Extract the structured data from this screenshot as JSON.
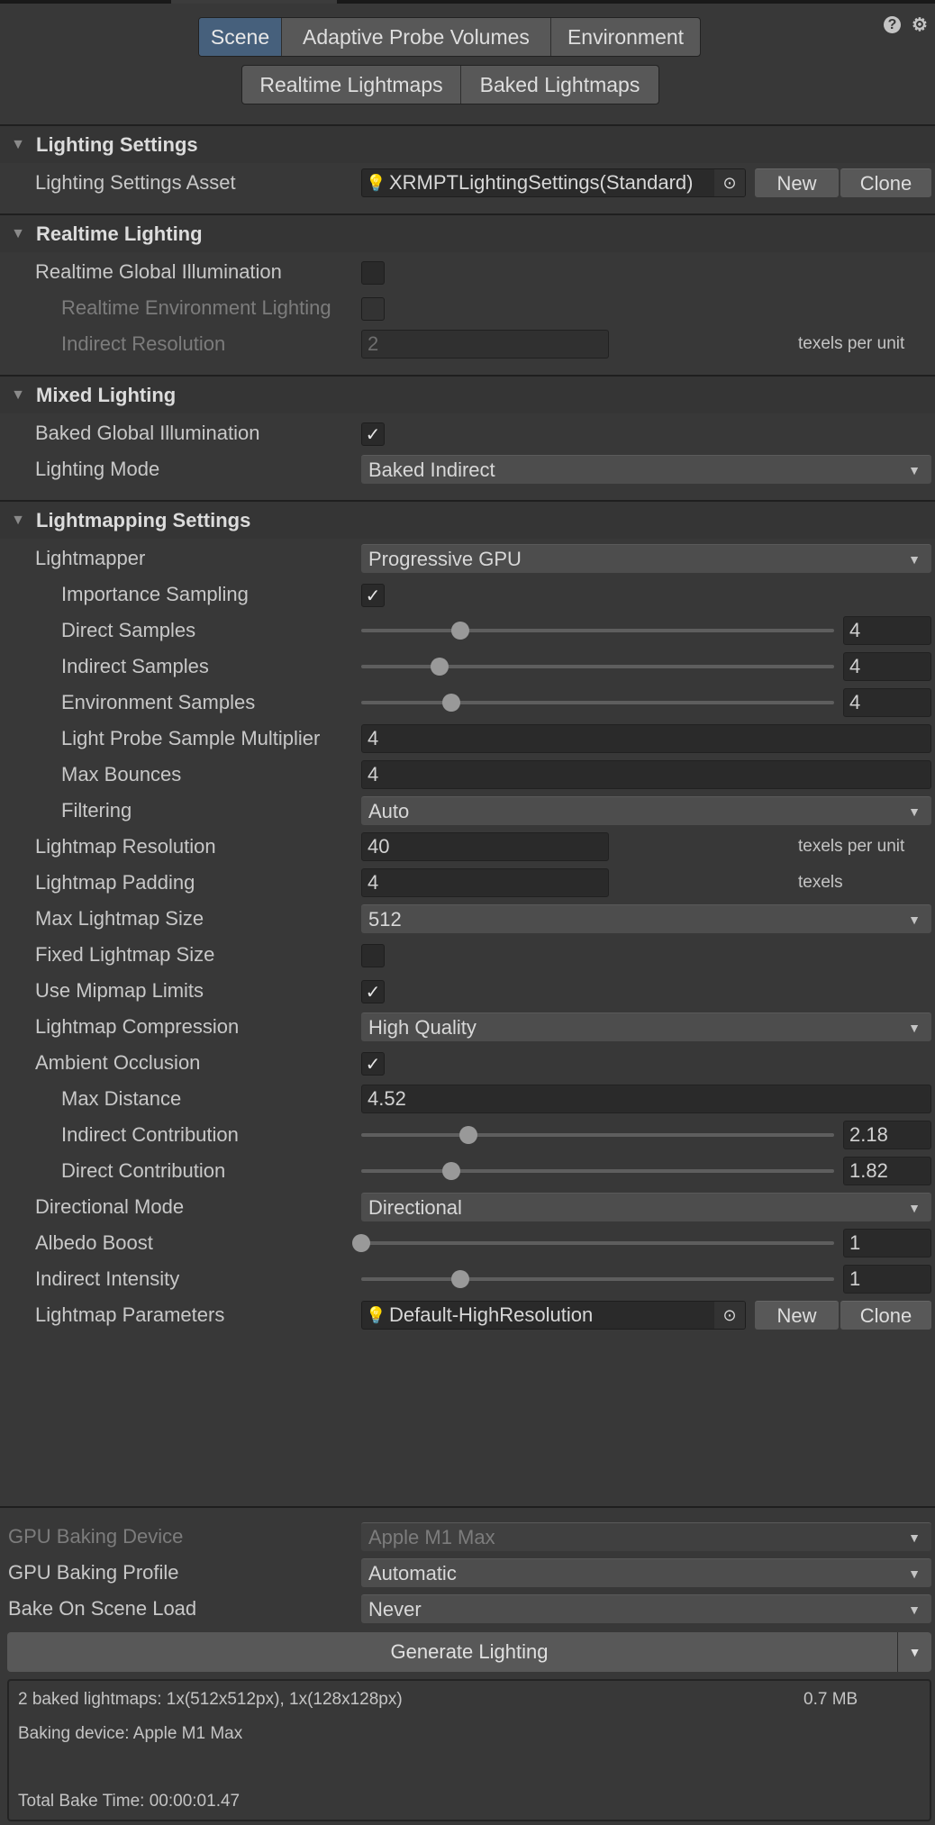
{
  "tabs": {
    "row1": [
      "Scene",
      "Adaptive Probe Volumes",
      "Environment"
    ],
    "row2": [
      "Realtime Lightmaps",
      "Baked Lightmaps"
    ],
    "selected": "Scene"
  },
  "icons": {
    "help": "?",
    "settings": "⚙"
  },
  "sections": [
    {
      "title": "Lighting Settings",
      "rows": [
        {
          "label": "Lighting Settings Asset",
          "type": "object",
          "value": "XRMPTLightingSettings(Standard)",
          "icon": "lightbulb-settings-icon",
          "new_label": "New",
          "clone_label": "Clone"
        }
      ]
    },
    {
      "title": "Realtime Lighting",
      "rows": [
        {
          "label": "Realtime Global Illumination",
          "type": "checkbox",
          "checked": false
        },
        {
          "label": "Realtime Environment Lighting",
          "type": "checkbox",
          "checked": false,
          "indent": true,
          "disabled": true
        },
        {
          "label": "Indirect Resolution",
          "type": "number",
          "value": "2",
          "units": "texels per unit",
          "indent": true,
          "disabled": true
        }
      ]
    },
    {
      "title": "Mixed Lighting",
      "rows": [
        {
          "label": "Baked Global Illumination",
          "type": "checkbox",
          "checked": true
        },
        {
          "label": "Lighting Mode",
          "type": "dropdown",
          "value": "Baked Indirect"
        }
      ]
    },
    {
      "title": "Lightmapping Settings",
      "rows": [
        {
          "label": "Lightmapper",
          "type": "dropdown",
          "value": "Progressive GPU"
        },
        {
          "label": "Importance Sampling",
          "type": "checkbox",
          "checked": true,
          "indent": true
        },
        {
          "label": "Direct Samples",
          "type": "slider",
          "value": "4",
          "slider_fraction": 0.21,
          "indent": true
        },
        {
          "label": "Indirect Samples",
          "type": "slider",
          "value": "4",
          "slider_fraction": 0.165,
          "indent": true
        },
        {
          "label": "Environment Samples",
          "type": "slider",
          "value": "4",
          "slider_fraction": 0.19,
          "indent": true
        },
        {
          "label": "Light Probe Sample Multiplier",
          "type": "number",
          "value": "4",
          "indent": true
        },
        {
          "label": "Max Bounces",
          "type": "number",
          "value": "4",
          "indent": true
        },
        {
          "label": "Filtering",
          "type": "dropdown",
          "value": "Auto",
          "indent": true
        },
        {
          "label": "Lightmap Resolution",
          "type": "number",
          "value": "40",
          "units": "texels per unit"
        },
        {
          "label": "Lightmap Padding",
          "type": "number",
          "value": "4",
          "units": "texels"
        },
        {
          "label": "Max Lightmap Size",
          "type": "dropdown",
          "value": "512"
        },
        {
          "label": "Fixed Lightmap Size",
          "type": "checkbox",
          "checked": false
        },
        {
          "label": "Use Mipmap Limits",
          "type": "checkbox",
          "checked": true
        },
        {
          "label": "Lightmap Compression",
          "type": "dropdown",
          "value": "High Quality"
        },
        {
          "label": "Ambient Occlusion",
          "type": "checkbox",
          "checked": true
        },
        {
          "label": "Max Distance",
          "type": "number",
          "value": "4.52",
          "indent": true
        },
        {
          "label": "Indirect Contribution",
          "type": "slider",
          "value": "2.18",
          "slider_fraction": 0.227,
          "indent": true
        },
        {
          "label": "Direct Contribution",
          "type": "slider",
          "value": "1.82",
          "slider_fraction": 0.19,
          "indent": true
        },
        {
          "label": "Directional Mode",
          "type": "dropdown",
          "value": "Directional"
        },
        {
          "label": "Albedo Boost",
          "type": "slider",
          "value": "1",
          "slider_fraction": 0.0
        },
        {
          "label": "Indirect Intensity",
          "type": "slider",
          "value": "1",
          "slider_fraction": 0.21
        },
        {
          "label": "Lightmap Parameters",
          "type": "object",
          "value": "Default-HighResolution",
          "icon": "lightmap-parameters-icon",
          "new_label": "New",
          "clone_label": "Clone"
        }
      ]
    }
  ],
  "bottom": {
    "rows": [
      {
        "label": "GPU Baking Device",
        "type": "dropdown",
        "value": "Apple M1 Max",
        "disabled": true
      },
      {
        "label": "GPU Baking Profile",
        "type": "dropdown",
        "value": "Automatic"
      },
      {
        "label": "Bake On Scene Load",
        "type": "dropdown",
        "value": "Never"
      }
    ],
    "generate_label": "Generate Lighting",
    "info": {
      "lightmaps": "2 baked lightmaps: 1x(512x512px), 1x(128x128px)",
      "size": "0.7 MB",
      "device": "Baking device: Apple M1 Max",
      "bake_time": "Total Bake Time: 00:00:01.47"
    }
  }
}
